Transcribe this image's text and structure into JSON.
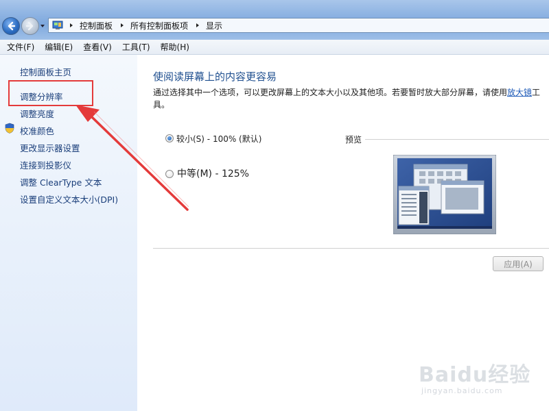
{
  "breadcrumb": [
    "控制面板",
    "所有控制面板项",
    "显示"
  ],
  "menu": [
    "文件(F)",
    "编辑(E)",
    "查看(V)",
    "工具(T)",
    "帮助(H)"
  ],
  "sidebar": {
    "items": [
      {
        "label": "控制面板主页"
      },
      {
        "label": "调整分辨率"
      },
      {
        "label": "调整亮度"
      },
      {
        "label": "校准颜色"
      },
      {
        "label": "更改显示器设置"
      },
      {
        "label": "连接到投影仪"
      },
      {
        "label": "调整 ClearType 文本"
      },
      {
        "label": "设置自定义文本大小(DPI)"
      }
    ]
  },
  "main": {
    "title": "使阅读屏幕上的内容更容易",
    "description": "通过选择其中一个选项，可以更改屏幕上的文本大小以及其他项。若要暂时放大部分屏幕，请使用",
    "description_link": "放大镜",
    "description_tail": "工具。",
    "options": [
      {
        "label": "较小(S) - 100% (默认)",
        "selected": true
      },
      {
        "label": "中等(M) - 125%",
        "selected": false
      }
    ],
    "preview_label": "预览",
    "apply_label": "应用(A)"
  },
  "watermark": {
    "brand": "Baidu经验",
    "url": "jingyan.baidu.com"
  },
  "colors": {
    "highlight": "#e43a3a",
    "link": "#1a3e7a",
    "title": "#1f4f8f"
  },
  "icons": {
    "back": "back-arrow-icon",
    "forward": "forward-arrow-icon",
    "folder": "control-panel-icon",
    "shield": "uac-shield-icon"
  }
}
